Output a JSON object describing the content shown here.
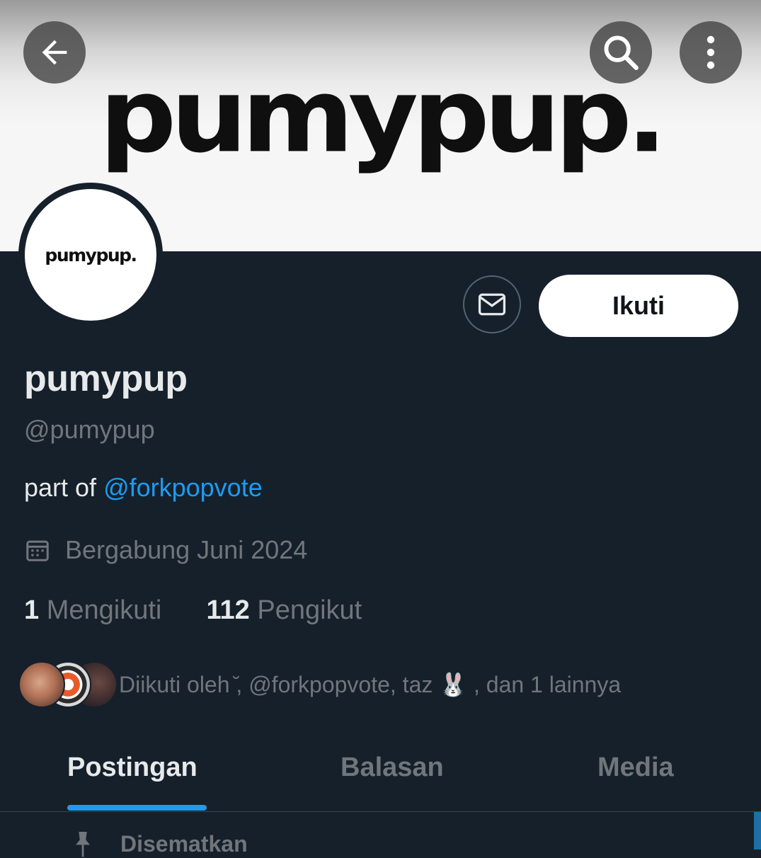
{
  "banner": {
    "logo_text": "pumypup."
  },
  "avatar": {
    "logo_text": "pumypup."
  },
  "header": {
    "back_icon": "arrow-left-icon",
    "search_icon": "search-icon",
    "more_icon": "more-vertical-icon"
  },
  "actions": {
    "message_icon": "mail-icon",
    "follow_label": "Ikuti"
  },
  "profile": {
    "name": "pumypup",
    "handle": "@pumypup",
    "bio_prefix": "part of ",
    "bio_mention": "@forkpopvote",
    "joined": "Bergabung Juni 2024",
    "following_count": "1",
    "following_label": "Mengikuti",
    "followers_count": "112",
    "followers_label": "Pengikut",
    "followed_by": "Diikuti oleh ̆, @forkpopvote, taz 🐰 , dan 1 lainnya"
  },
  "tabs": [
    {
      "label": "Postingan",
      "active": true
    },
    {
      "label": "Balasan",
      "active": false
    },
    {
      "label": "Media",
      "active": false
    }
  ],
  "pinned": {
    "label": "Disematkan"
  },
  "colors": {
    "accent": "#1d9bf0",
    "background": "#15202b",
    "muted": "#71767b"
  }
}
